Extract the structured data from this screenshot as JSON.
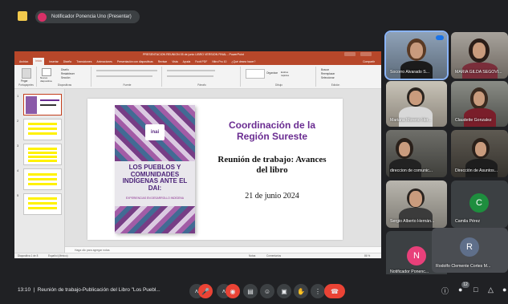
{
  "meet": {
    "presenter_label": "Notificador Ponencia Uno (Presentar)",
    "presenter_initial": "N",
    "time": "13:10",
    "meeting_title": "Reunión de trabajo-Publicación del Libro \"Los Puebl...",
    "participant_count": "12",
    "colors": {
      "accent": "#8ab4f8",
      "hangup": "#ea4335"
    }
  },
  "powerpoint": {
    "title": "PRESENTACION REUNION 05 de junio LIBRO VERSION FINAL - PowerPoint",
    "tabs": [
      "Archivo",
      "Inicio",
      "Insertar",
      "Diseño",
      "Transiciones",
      "Animaciones",
      "Presentación con diapositivas",
      "Revisar",
      "Vista",
      "Ayuda",
      "Foxit PDF",
      "Nitro Pro 10",
      "¿Qué desea hacer?"
    ],
    "share_label": "Compartir",
    "ribbon_groups": [
      "Portapapeles",
      "Diapositivas",
      "Fuente",
      "Párrafo",
      "Dibujo",
      "Edición"
    ],
    "ribbon_items": [
      "Pegar",
      "Nueva diapositiva",
      "Diseño",
      "Restablecer",
      "Sección",
      "Organizar",
      "Estilos rápidos",
      "Buscar",
      "Reemplazar",
      "Seleccionar"
    ],
    "slide_numbers": [
      "1",
      "2",
      "3",
      "4",
      "5"
    ],
    "notes_placeholder": "Haga clic para agregar notas",
    "status_left": "Diapositiva 1 de 8",
    "status_lang": "Español (México)",
    "status_notes": "Notas",
    "status_comments": "Comentarios",
    "zoom": "86 %"
  },
  "slide": {
    "book_logo": "inai",
    "book_title": "LOS PUEBLOS Y COMUNIDADES INDÍGENAS ANTE EL DAI:",
    "book_subtitle": "EXPERIENCIAS EN DESARROLLO INDÍGENA",
    "heading": "Coordinación de la Región Sureste",
    "subheading": "Reunión de trabajo: Avances del libro",
    "date": "21 de junio 2024",
    "colors": {
      "heading": "#6a2c91"
    }
  },
  "participants": [
    {
      "name": "Socorro Alvarado S...",
      "initial": ""
    },
    {
      "name": "MARIA GILDA SEGOVI...",
      "initial": ""
    },
    {
      "name": "Mariana Moreno Her...",
      "initial": ""
    },
    {
      "name": "Claudette Gonzalez",
      "initial": ""
    },
    {
      "name": "direccion de comunic...",
      "initial": ""
    },
    {
      "name": "Dirección de Asuntos...",
      "initial": ""
    },
    {
      "name": "Sergio Alberto Hernán...",
      "initial": ""
    },
    {
      "name": "Camila Pérez",
      "initial": "C"
    },
    {
      "name": "Notificador Ponenc...",
      "initial": "N"
    },
    {
      "name": "Rodolfo Clemente Cortes M...",
      "initial": "R"
    }
  ]
}
